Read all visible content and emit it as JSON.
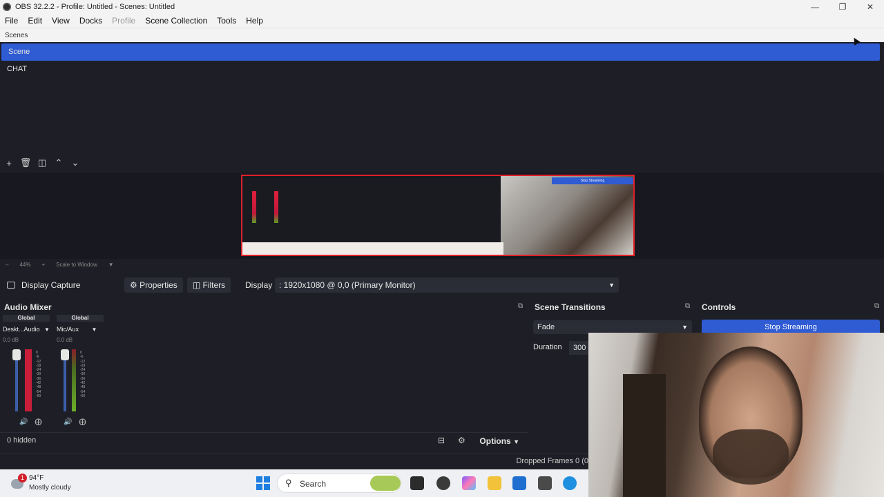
{
  "window": {
    "title": "OBS 32.2.2 - Profile: Untitled - Scenes: Untitled"
  },
  "menu": [
    "File",
    "Edit",
    "View",
    "Docks",
    "Profile",
    "Scene Collection",
    "Tools",
    "Help"
  ],
  "scenes": {
    "header": "Scenes",
    "items": [
      {
        "label": "Scene",
        "selected": true
      },
      {
        "label": "CHAT",
        "selected": false
      }
    ]
  },
  "preview": {
    "zoom": "44%",
    "scale_mode": "Scale to Window",
    "stop_label": "Stop Streaming"
  },
  "source_toolbar": {
    "source_name": "Display Capture",
    "properties_label": "Properties",
    "filters_label": "Filters",
    "display_label": "Display",
    "display_value": ": 1920x1080 @ 0,0 (Primary Monitor)"
  },
  "audio_mixer": {
    "title": "Audio Mixer",
    "channels": [
      {
        "badge": "Global",
        "name": "Deskt...Audio",
        "db": "0.0 dB"
      },
      {
        "badge": "Global",
        "name": "Mic/Aux",
        "db": "0.0 dB"
      }
    ],
    "scale": [
      "0",
      "-6",
      "-12",
      "-18",
      "-24",
      "-30",
      "-36",
      "-42",
      "-48",
      "-54",
      "-60"
    ],
    "hidden_label": "0 hidden",
    "options_label": "Options"
  },
  "scene_transitions": {
    "title": "Scene Transitions",
    "transition": "Fade",
    "duration_label": "Duration",
    "duration_value": "300"
  },
  "controls": {
    "title": "Controls",
    "stop_streaming_label": "Stop Streaming"
  },
  "status": {
    "dropped_frames": "Dropped Frames 0 (0"
  },
  "taskbar": {
    "weather_badge": "1",
    "temperature": "94°F",
    "weather": "Mostly cloudy",
    "search_label": "Search"
  },
  "colors": {
    "accent": "#2f5bd3",
    "background": "#1e1f26",
    "preview_border": "#e0202a"
  }
}
